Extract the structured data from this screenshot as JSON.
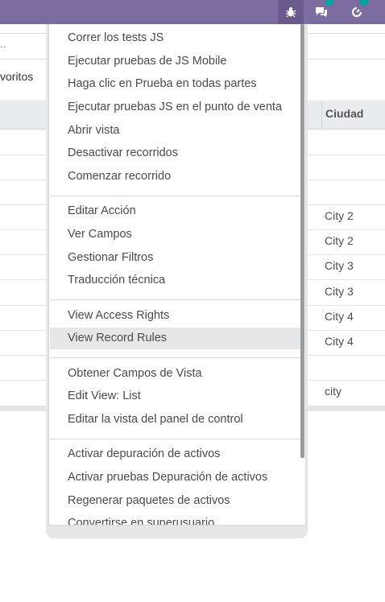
{
  "navbar": {
    "icons": [
      "bug-icon",
      "chat-icon",
      "activity-icon"
    ]
  },
  "list": {
    "search_placeholder": "..",
    "favorites_label": "voritos",
    "column_header": "Ciudad",
    "cells": [
      "City 2",
      "City 2",
      "City 3",
      "City 3",
      "City 4",
      "City 4",
      "",
      "city"
    ]
  },
  "debug_menu": {
    "groups": [
      [
        "Correr los tests JS",
        "Ejecutar pruebas de JS Mobile",
        "Haga clic en Prueba en todas partes",
        "Ejecutar pruebas JS en el punto de venta",
        "Abrir vista",
        "Desactivar recorridos",
        "Comenzar recorrido"
      ],
      [
        "Editar Acción",
        "Ver Campos",
        "Gestionar Filtros",
        "Traducción técnica"
      ],
      [
        "View Access Rights",
        "View Record Rules"
      ],
      [
        "Obtener Campos de Vista",
        "Edit View: List",
        "Editar la vista del panel de control"
      ],
      [
        "Activar depuración de activos",
        "Activar pruebas Depuración de activos",
        "Regenerar paquetes de activos",
        "Convertirse en superusuario"
      ]
    ],
    "highlighted": "View Record Rules"
  }
}
